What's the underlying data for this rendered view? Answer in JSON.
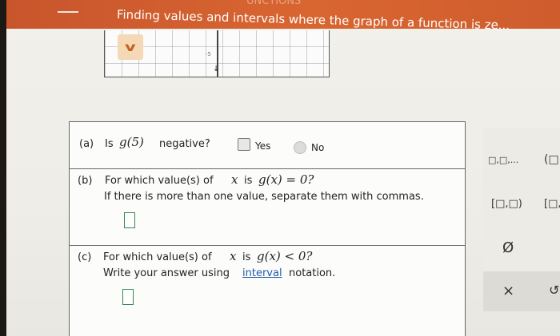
{
  "header": {
    "faint_text": "UNCTIONS",
    "title": "Finding values and intervals where the graph of a function is ze..."
  },
  "graph": {
    "tick_label": "-5"
  },
  "questions": {
    "a": {
      "label": "(a)",
      "prefix": "Is",
      "math": "g(5)",
      "suffix": "negative?",
      "yes_label": "Yes",
      "no_label": "No"
    },
    "b": {
      "label": "(b)",
      "line1_prefix": "For which value(s) of",
      "line1_var": "x",
      "line1_is": "is",
      "line1_math": "g(x) = 0?",
      "line2": "If there is more than one value, separate them with commas."
    },
    "c": {
      "label": "(c)",
      "line1_prefix": "For which value(s) of",
      "line1_var": "x",
      "line1_is": "is",
      "line1_math": "g(x) < 0?",
      "line2_prefix": "Write your answer using",
      "line2_link": "interval",
      "line2_suffix": "notation."
    }
  },
  "keypad": {
    "list_key": "□,□,...",
    "open_paren_key": "(□",
    "closed_interval_key": "[□,□)",
    "bracket_key": "[□,",
    "empty_set_key": "Ø",
    "clear_key": "×",
    "undo_key": "↺"
  },
  "colors": {
    "accent": "#d96631",
    "input_border": "#2e8b4f",
    "link": "#1f5aa8"
  }
}
